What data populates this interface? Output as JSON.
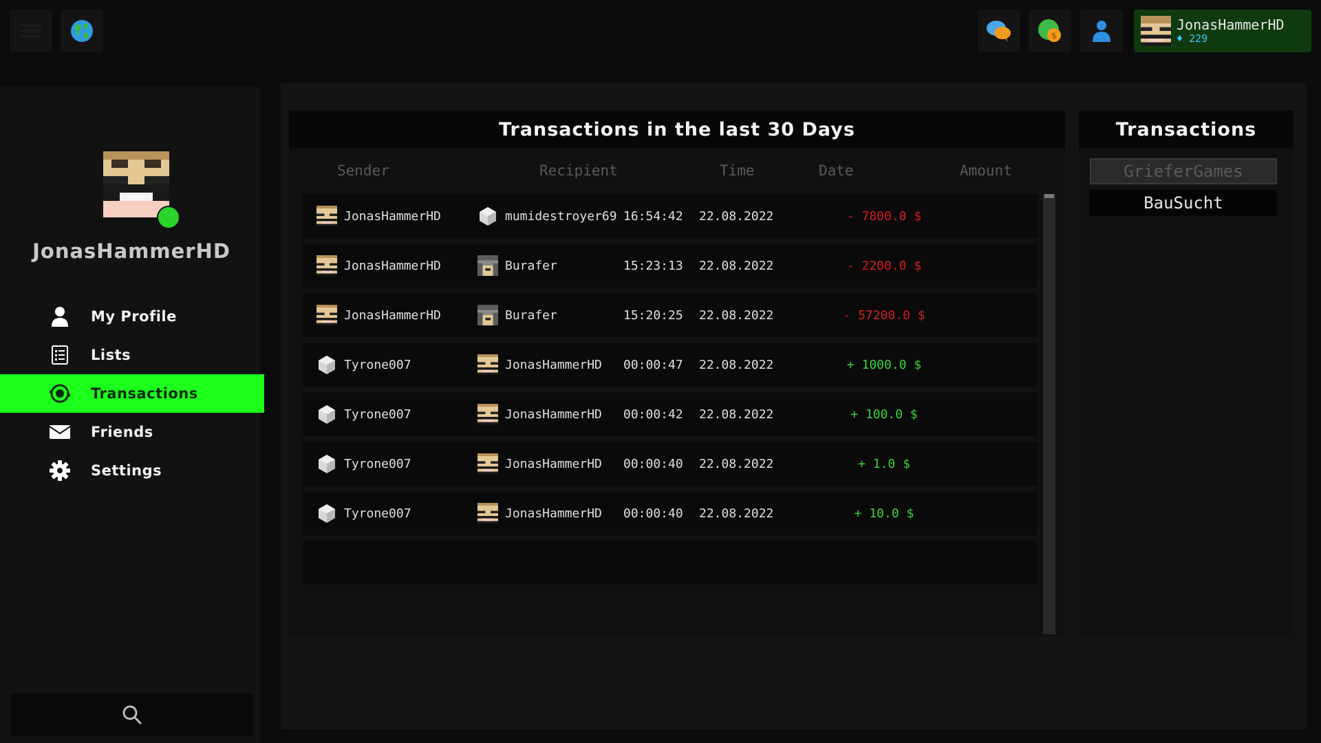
{
  "topbar": {
    "icons": [
      "menu-icon",
      "globe-icon",
      "chat-icon",
      "coins-icon",
      "friends-icon"
    ],
    "user": {
      "name": "JonasHammerHD",
      "gems": "229"
    }
  },
  "sidebar": {
    "username": "JonasHammerHD",
    "status": "online",
    "items": [
      {
        "label": "My Profile",
        "icon": "person-icon",
        "active": false
      },
      {
        "label": "Lists",
        "icon": "list-icon",
        "active": false
      },
      {
        "label": "Transactions",
        "icon": "money-icon",
        "active": true
      },
      {
        "label": "Friends",
        "icon": "mail-icon",
        "active": false
      },
      {
        "label": "Settings",
        "icon": "gear-icon",
        "active": false
      }
    ]
  },
  "transactions": {
    "title": "Transactions in the last 30 Days",
    "columns": [
      "Sender",
      "Recipient",
      "Time",
      "Date",
      "Amount"
    ],
    "rows": [
      {
        "sender": "JonasHammerHD",
        "recipient": "mumidestroyer69",
        "time": "16:54:42",
        "date": "22.08.2022",
        "amount": "- 7800.0 $",
        "type": "neg"
      },
      {
        "sender": "JonasHammerHD",
        "recipient": "Burafer",
        "time": "15:23:13",
        "date": "22.08.2022",
        "amount": "- 2200.0 $",
        "type": "neg"
      },
      {
        "sender": "JonasHammerHD",
        "recipient": "Burafer",
        "time": "15:20:25",
        "date": "22.08.2022",
        "amount": "- 57200.0 $",
        "type": "neg"
      },
      {
        "sender": "Tyrone007",
        "recipient": "JonasHammerHD",
        "time": "00:00:47",
        "date": "22.08.2022",
        "amount": "+ 1000.0 $",
        "type": "pos"
      },
      {
        "sender": "Tyrone007",
        "recipient": "JonasHammerHD",
        "time": "00:00:42",
        "date": "22.08.2022",
        "amount": "+ 100.0 $",
        "type": "pos"
      },
      {
        "sender": "Tyrone007",
        "recipient": "JonasHammerHD",
        "time": "00:00:40",
        "date": "22.08.2022",
        "amount": "+ 1.0 $",
        "type": "pos"
      },
      {
        "sender": "Tyrone007",
        "recipient": "JonasHammerHD",
        "time": "00:00:40",
        "date": "22.08.2022",
        "amount": "+ 10.0 $",
        "type": "pos"
      }
    ]
  },
  "servers": {
    "title": "Transactions",
    "items": [
      {
        "label": "GrieferGames",
        "selected": true
      },
      {
        "label": "BauSucht",
        "selected": false
      }
    ]
  },
  "colors": {
    "accent": "#1cff1c",
    "negative": "#d21f1f",
    "positive": "#3ed23e",
    "gems": "#3ec6ff"
  }
}
